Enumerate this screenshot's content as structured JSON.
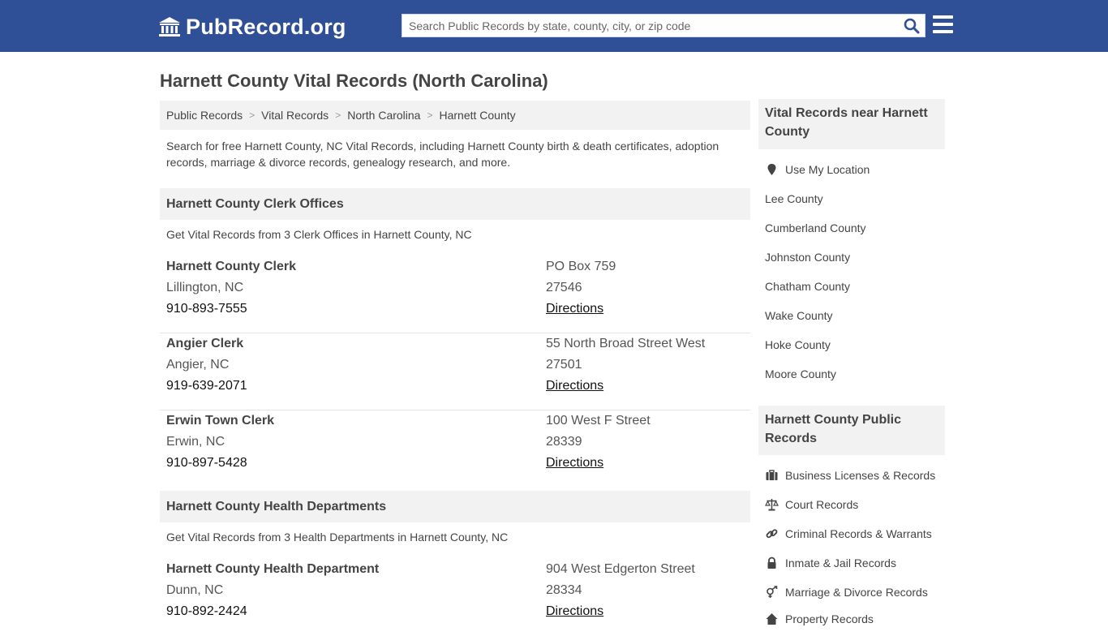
{
  "header": {
    "logo_text": "PubRecord.org",
    "search_placeholder": "Search Public Records by state, county, city, or zip code",
    "brand_color": "#2f4f96"
  },
  "page_title": "Harnett County Vital Records (North Carolina)",
  "breadcrumbs": [
    "Public Records",
    "Vital Records",
    "North Carolina",
    "Harnett County"
  ],
  "intro": "Search for free Harnett County, NC Vital Records, including Harnett County birth & death certificates, adoption records, marriage & divorce records, genealogy research, and more.",
  "clerk_section": {
    "title": "Harnett County Clerk Offices",
    "subtitle": "Get Vital Records from 3 Clerk Offices in Harnett County, NC",
    "entries": [
      {
        "name": "Harnett County Clerk",
        "city": "Lillington, NC",
        "phone": "910-893-7555",
        "address": "PO Box 759",
        "zip": "27546",
        "directions": "Directions"
      },
      {
        "name": "Angier Clerk",
        "city": "Angier, NC",
        "phone": "919-639-2071",
        "address": "55 North Broad Street West",
        "zip": "27501",
        "directions": "Directions"
      },
      {
        "name": "Erwin Town Clerk",
        "city": "Erwin, NC",
        "phone": "910-897-5428",
        "address": "100 West F Street",
        "zip": "28339",
        "directions": "Directions"
      }
    ]
  },
  "health_section": {
    "title": "Harnett County Health Departments",
    "subtitle": "Get Vital Records from 3 Health Departments in Harnett County, NC",
    "entries": [
      {
        "name": "Harnett County Health Department",
        "city": "Dunn, NC",
        "phone": "910-892-2424",
        "address": "904 West Edgerton Street",
        "zip": "28334",
        "directions": "Directions"
      }
    ]
  },
  "sidebar": {
    "nearby_title": "Vital Records near Harnett County",
    "use_location": "Use My Location",
    "nearby": [
      "Lee County",
      "Cumberland County",
      "Johnston County",
      "Chatham County",
      "Wake County",
      "Hoke County",
      "Moore County"
    ],
    "public_title": "Harnett County Public Records",
    "public_links": [
      {
        "label": "Business Licenses & Records",
        "icon": "briefcase-icon"
      },
      {
        "label": "Court Records",
        "icon": "scales-icon"
      },
      {
        "label": "Criminal Records & Warrants",
        "icon": "link-icon"
      },
      {
        "label": "Inmate & Jail Records",
        "icon": "lock-icon"
      },
      {
        "label": "Marriage & Divorce Records",
        "icon": "gender-icon"
      },
      {
        "label": "Property Records",
        "icon": "home-icon"
      }
    ]
  }
}
